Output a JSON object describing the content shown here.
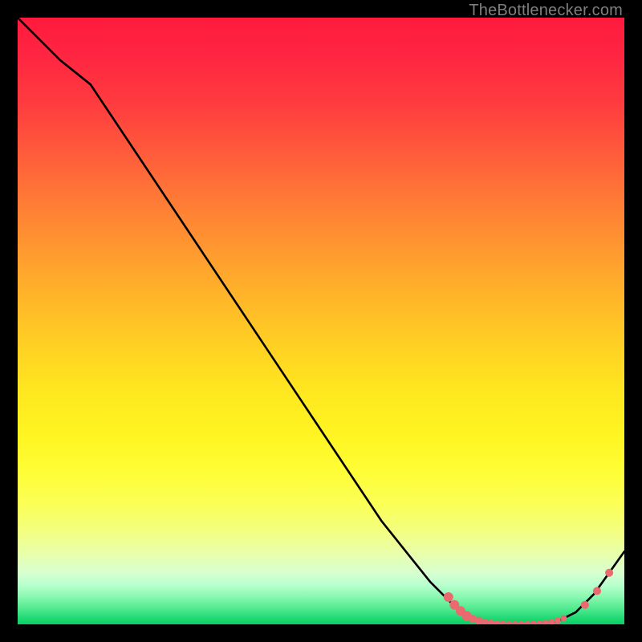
{
  "watermark": {
    "text": "TheBottlenecker.com"
  },
  "chart_data": {
    "type": "line",
    "title": "",
    "xlabel": "",
    "ylabel": "",
    "xlim": [
      0,
      100
    ],
    "ylim": [
      0,
      100
    ],
    "grid": false,
    "curve": [
      {
        "x": 0,
        "y": 100
      },
      {
        "x": 7,
        "y": 93
      },
      {
        "x": 12,
        "y": 89
      },
      {
        "x": 20,
        "y": 77
      },
      {
        "x": 30,
        "y": 62
      },
      {
        "x": 40,
        "y": 47
      },
      {
        "x": 50,
        "y": 32
      },
      {
        "x": 60,
        "y": 17
      },
      {
        "x": 68,
        "y": 7
      },
      {
        "x": 73,
        "y": 2
      },
      {
        "x": 76,
        "y": 0.5
      },
      {
        "x": 80,
        "y": 0
      },
      {
        "x": 85,
        "y": 0
      },
      {
        "x": 89,
        "y": 0.5
      },
      {
        "x": 92,
        "y": 2
      },
      {
        "x": 95,
        "y": 5
      },
      {
        "x": 100,
        "y": 12
      }
    ],
    "markers": [
      {
        "x": 71,
        "y": 4.5,
        "r": 6
      },
      {
        "x": 72,
        "y": 3.2,
        "r": 6
      },
      {
        "x": 73,
        "y": 2.2,
        "r": 6
      },
      {
        "x": 74,
        "y": 1.4,
        "r": 6
      },
      {
        "x": 75,
        "y": 0.9,
        "r": 5
      },
      {
        "x": 76,
        "y": 0.6,
        "r": 5
      },
      {
        "x": 77,
        "y": 0.4,
        "r": 4
      },
      {
        "x": 78,
        "y": 0.25,
        "r": 4
      },
      {
        "x": 79,
        "y": 0.15,
        "r": 4
      },
      {
        "x": 80,
        "y": 0.05,
        "r": 4
      },
      {
        "x": 81,
        "y": 0.0,
        "r": 4
      },
      {
        "x": 82,
        "y": 0.0,
        "r": 4
      },
      {
        "x": 83,
        "y": 0.0,
        "r": 4
      },
      {
        "x": 84,
        "y": 0.0,
        "r": 4
      },
      {
        "x": 85,
        "y": 0.05,
        "r": 4
      },
      {
        "x": 86,
        "y": 0.1,
        "r": 4
      },
      {
        "x": 87,
        "y": 0.2,
        "r": 4
      },
      {
        "x": 88,
        "y": 0.35,
        "r": 4
      },
      {
        "x": 89,
        "y": 0.6,
        "r": 4
      },
      {
        "x": 90,
        "y": 1.0,
        "r": 4
      },
      {
        "x": 93.5,
        "y": 3.2,
        "r": 5
      },
      {
        "x": 95.5,
        "y": 5.5,
        "r": 5
      },
      {
        "x": 97.5,
        "y": 8.5,
        "r": 5
      }
    ],
    "gradient_stops": [
      {
        "offset": 0.0,
        "color": "#ff1a3d"
      },
      {
        "offset": 0.06,
        "color": "#ff2542"
      },
      {
        "offset": 0.14,
        "color": "#ff3b3f"
      },
      {
        "offset": 0.22,
        "color": "#ff5a3b"
      },
      {
        "offset": 0.3,
        "color": "#ff7a36"
      },
      {
        "offset": 0.38,
        "color": "#ff9830"
      },
      {
        "offset": 0.46,
        "color": "#ffb529"
      },
      {
        "offset": 0.54,
        "color": "#ffd023"
      },
      {
        "offset": 0.62,
        "color": "#ffe81f"
      },
      {
        "offset": 0.69,
        "color": "#fff522"
      },
      {
        "offset": 0.745,
        "color": "#fffd35"
      },
      {
        "offset": 0.8,
        "color": "#fbff55"
      },
      {
        "offset": 0.845,
        "color": "#f3ff7e"
      },
      {
        "offset": 0.885,
        "color": "#e8ffad"
      },
      {
        "offset": 0.915,
        "color": "#d8ffd0"
      },
      {
        "offset": 0.935,
        "color": "#b9ffcf"
      },
      {
        "offset": 0.955,
        "color": "#88f8af"
      },
      {
        "offset": 0.975,
        "color": "#4fe98e"
      },
      {
        "offset": 0.99,
        "color": "#1fd973"
      },
      {
        "offset": 1.0,
        "color": "#08cf65"
      }
    ],
    "marker_color": "#e96a6f",
    "line_color": "#000000"
  }
}
